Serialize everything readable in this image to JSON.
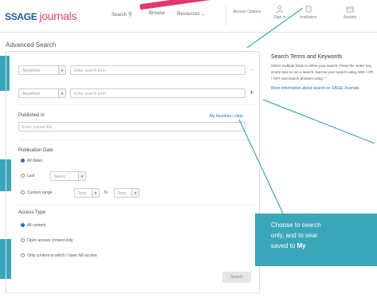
{
  "header": {
    "logo_brand": "SSAGE",
    "logo_product": "journals",
    "nav": [
      "Search",
      "Browse",
      "Resources"
    ],
    "search_label": "Search",
    "access_options": "Access Options",
    "icons": [
      {
        "name": "sign-in-icon",
        "label": "Sign in"
      },
      {
        "name": "institution-icon",
        "label": "Institution"
      },
      {
        "name": "society-icon",
        "label": "Society"
      }
    ]
  },
  "page_title": "Advanced Search",
  "search_rows": [
    {
      "field": "Anywhere",
      "placeholder": "Enter search term"
    },
    {
      "field": "Anywhere",
      "placeholder": "Enter search term"
    }
  ],
  "published_in": {
    "label": "Published in",
    "link": "My favorites / clear",
    "placeholder": "Enter journal title"
  },
  "publication_date": {
    "label": "Publication Date",
    "options": [
      "All dates",
      "Last",
      "Custom range"
    ],
    "last_select": "Select",
    "year_from": "Year",
    "to": "To",
    "year_to": "Year"
  },
  "access_type": {
    "label": "Access Type",
    "options": [
      "All content",
      "Open access content only",
      "Only content to which I have full access"
    ]
  },
  "search_button": "Search",
  "sidebar": {
    "title": "Search Terms and Keywords",
    "text": "Select multiple fields to refine your search. Press the 'enter' key at any time to run a search. Narrow your search using AND / OR / NOT and search phrases using \" \".",
    "link": "More information about search on SAGE Journals"
  },
  "callout": {
    "line1": "Choose to search",
    "line2": "only, and to sear",
    "line3_pre": "saved to",
    "line3_bold": "My"
  },
  "colors": {
    "accent": "#3aa6b9",
    "brand": "#1f5c99",
    "pink": "#e2396a"
  }
}
